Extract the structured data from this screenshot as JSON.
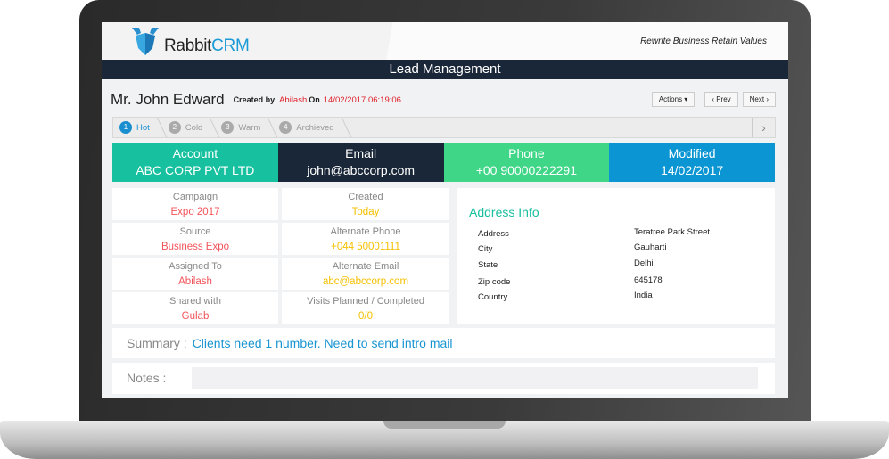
{
  "header": {
    "logo_text_a": "Rabbit",
    "logo_text_b": "CRM",
    "tagline": "Rewrite Business Retain Values"
  },
  "nav": {
    "title": "Lead Management"
  },
  "lead": {
    "name": "Mr. John Edward",
    "created_by_label": "Created by",
    "created_by": "Abilash",
    "on_label": "On",
    "created_on": "14/02/2017 06:19:06"
  },
  "buttons": {
    "actions": "Actions ▾",
    "prev": "‹ Prev",
    "next": "Next ›"
  },
  "steps": [
    {
      "num": "1",
      "label": "Hot",
      "active": true
    },
    {
      "num": "2",
      "label": "Cold"
    },
    {
      "num": "3",
      "label": "Warm"
    },
    {
      "num": "4",
      "label": "Archieved"
    }
  ],
  "cards": [
    {
      "label": "Account",
      "value": "ABC CORP PVT LTD",
      "color": "#17c09f"
    },
    {
      "label": "Email",
      "value": "john@abccorp.com",
      "color": "#1a2738"
    },
    {
      "label": "Phone",
      "value": "+00 90000222291",
      "color": "#40d688"
    },
    {
      "label": "Modified",
      "value": "14/02/2017",
      "color": "#0b96d3"
    }
  ],
  "left_fields": [
    {
      "label": "Campaign",
      "value": "Expo 2017"
    },
    {
      "label": "Source",
      "value": "Business Expo"
    },
    {
      "label": "Assigned To",
      "value": "Abilash"
    },
    {
      "label": "Shared with",
      "value": "Gulab"
    }
  ],
  "mid_fields": [
    {
      "label": "Created",
      "value": "Today"
    },
    {
      "label": "Alternate Phone",
      "value": "+044 50001111"
    },
    {
      "label": "Alternate Email",
      "value": "abc@abccorp.com"
    },
    {
      "label": "Visits Planned / Completed",
      "value": "0/0"
    }
  ],
  "address": {
    "title": "Address Info",
    "rows": [
      {
        "label": "Address",
        "value": "Teratree Park Street"
      },
      {
        "label": "City",
        "value": "Gauharti"
      },
      {
        "label": "State",
        "value": "Delhi"
      },
      {
        "label": "Zip code",
        "value": "645178"
      },
      {
        "label": "Country",
        "value": "India"
      }
    ]
  },
  "summary": {
    "label": "Summary :",
    "value": "Clients need 1 number. Need to send intro mail"
  },
  "notes": {
    "label": "Notes :",
    "value": ""
  },
  "colors": {
    "left_value": "#f2545b",
    "mid_value": "#f5c000",
    "accent": "#1a95d2"
  }
}
